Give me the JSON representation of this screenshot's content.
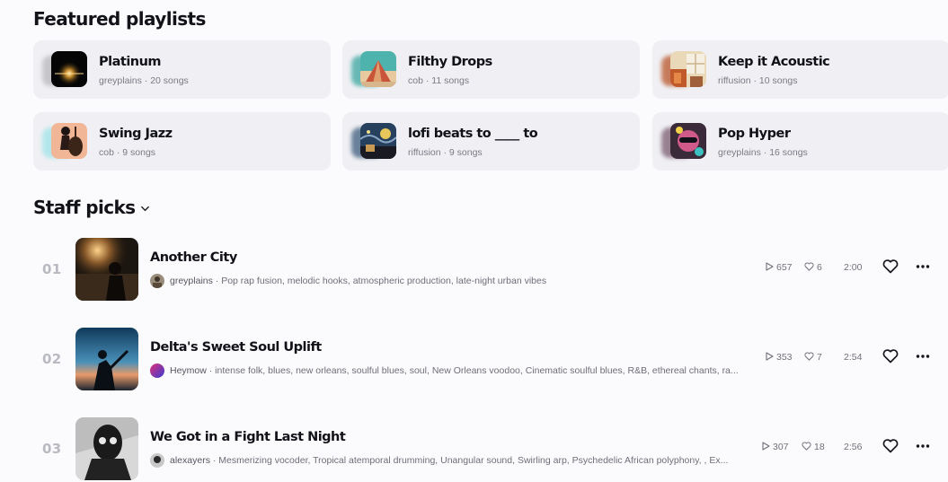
{
  "featured": {
    "title": "Featured playlists",
    "playlists": [
      {
        "name": "Platinum",
        "meta": "greyplains · 20 songs",
        "icon": "platinum-art"
      },
      {
        "name": "Filthy Drops",
        "meta": "cob · 11 songs",
        "icon": "mountain-art"
      },
      {
        "name": "Keep it Acoustic",
        "meta": "riffusion · 10 songs",
        "icon": "window-art"
      },
      {
        "name": "Swing Jazz",
        "meta": "cob · 9 songs",
        "icon": "bass-player-art"
      },
      {
        "name": "lofi beats to ____ to",
        "meta": "riffusion · 9 songs",
        "icon": "starry-night-art"
      },
      {
        "name": "Pop Hyper",
        "meta": "greyplains · 16 songs",
        "icon": "pop-art"
      }
    ]
  },
  "staff_picks": {
    "title": "Staff picks",
    "tracks": [
      {
        "rank": "01",
        "title": "Another City",
        "user": "greyplains",
        "tags": "· Pop rap fusion, melodic hooks, atmospheric production, late-night urban vibes",
        "plays": "657",
        "likes": "6",
        "duration": "2:00"
      },
      {
        "rank": "02",
        "title": "Delta's Sweet Soul Uplift",
        "user": "Heymow",
        "tags": "· intense folk, blues, new orleans, soulful blues, soul, New Orleans voodoo, Cinematic soulful blues, R&B, ethereal chants, ra...",
        "plays": "353",
        "likes": "7",
        "duration": "2:54"
      },
      {
        "rank": "03",
        "title": "We Got in a Fight Last Night",
        "user": "alexayers",
        "tags": "· Mesmerizing vocoder, Tropical atemporal drumming, Unangular sound, Swirling arp, Psychedelic African polyphony, , Ex...",
        "plays": "307",
        "likes": "18",
        "duration": "2:56"
      }
    ]
  }
}
